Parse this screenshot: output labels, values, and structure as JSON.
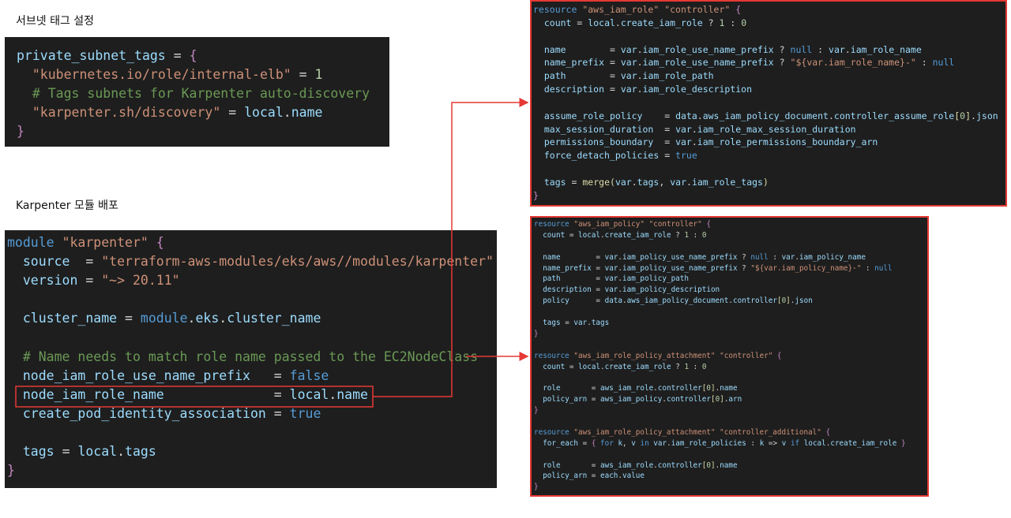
{
  "headings": {
    "subnet_tags": "서브넷 태그 설정",
    "karpenter_module": "Karpenter 모듈 배포"
  },
  "subnet_code": [
    "private_subnet_tags = {",
    "  \"kubernetes.io/role/internal-elb\" = 1",
    "  # Tags subnets for Karpenter auto-discovery",
    "  \"karpenter.sh/discovery\" = local.name",
    "}"
  ],
  "module_code": [
    "module \"karpenter\" {",
    "  source  = \"terraform-aws-modules/eks/aws//modules/karpenter\"",
    "  version = \"~> 20.11\"",
    "",
    "  cluster_name = module.eks.cluster_name",
    "",
    "  # Name needs to match role name passed to the EC2NodeClass",
    "  node_iam_role_use_name_prefix   = false",
    "  node_iam_role_name              = local.name",
    "  create_pod_identity_association = true",
    "",
    "  tags = local.tags",
    "}"
  ],
  "role_code": [
    "resource \"aws_iam_role\" \"controller\" {",
    "  count = local.create_iam_role ? 1 : 0",
    "",
    "  name        = var.iam_role_use_name_prefix ? null : var.iam_role_name",
    "  name_prefix = var.iam_role_use_name_prefix ? \"${var.iam_role_name}-\" : null",
    "  path        = var.iam_role_path",
    "  description = var.iam_role_description",
    "",
    "  assume_role_policy    = data.aws_iam_policy_document.controller_assume_role[0].json",
    "  max_session_duration  = var.iam_role_max_session_duration",
    "  permissions_boundary  = var.iam_role_permissions_boundary_arn",
    "  force_detach_policies = true",
    "",
    "  tags = merge(var.tags, var.iam_role_tags)",
    "}"
  ],
  "policy_code": [
    "resource \"aws_iam_policy\" \"controller\" {",
    "  count = local.create_iam_role ? 1 : 0",
    "",
    "  name        = var.iam_policy_use_name_prefix ? null : var.iam_policy_name",
    "  name_prefix = var.iam_policy_use_name_prefix ? \"${var.iam_policy_name}-\" : null",
    "  path        = var.iam_policy_path",
    "  description = var.iam_policy_description",
    "  policy      = data.aws_iam_policy_document.controller[0].json",
    "",
    "  tags = var.tags",
    "}",
    "",
    "resource \"aws_iam_role_policy_attachment\" \"controller\" {",
    "  count = local.create_iam_role ? 1 : 0",
    "",
    "  role       = aws_iam_role.controller[0].name",
    "  policy_arn = aws_iam_policy.controller[0].arn",
    "}",
    "",
    "resource \"aws_iam_role_policy_attachment\" \"controller_additional\" {",
    "  for_each = { for k, v in var.iam_role_policies : k => v if local.create_iam_role }",
    "",
    "  role       = aws_iam_role.controller[0].name",
    "  policy_arn = each.value",
    "}"
  ],
  "colors": {
    "panel_bg": "#1e1e1e",
    "highlight": "#e53935",
    "string": "#ce9178",
    "keyword": "#569cd6",
    "comment": "#6a9955",
    "identifier": "#9cdcfe",
    "number": "#b5cea8",
    "brace": "#c586c0"
  }
}
